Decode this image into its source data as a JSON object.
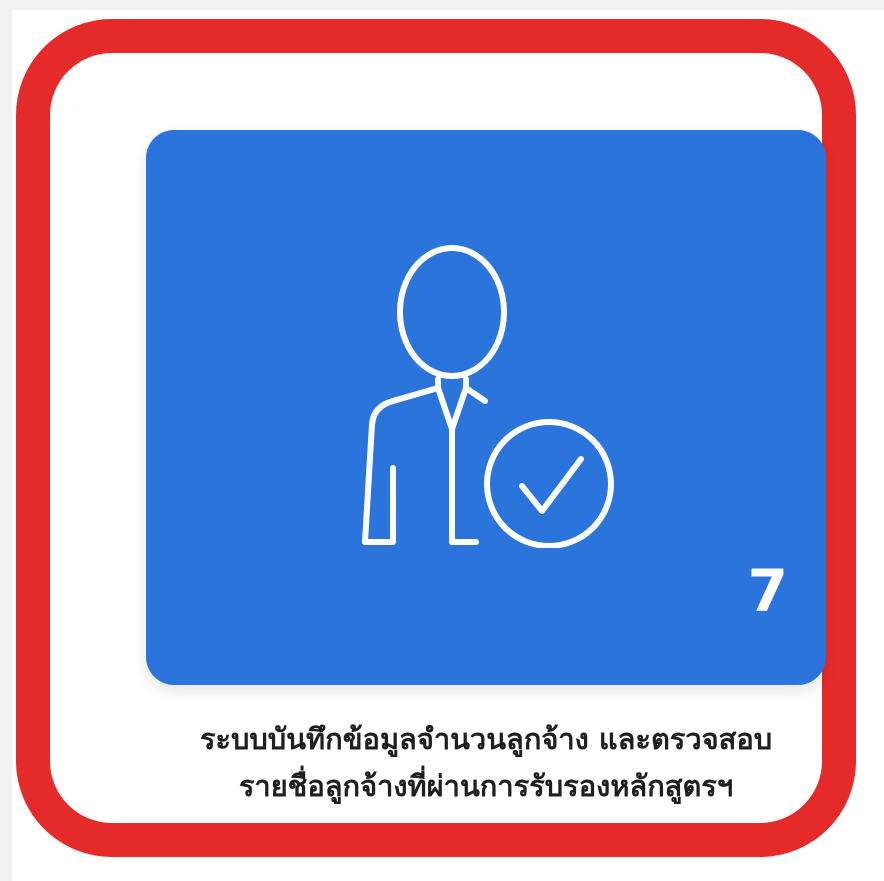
{
  "card": {
    "icon": "user-verified-icon",
    "count": "7",
    "caption_line1": "ระบบบันทึกข้อมูลจำนวนลูกจ้าง และตรวจสอบ",
    "caption_line2": "รายชื่อลูกจ้างที่ผ่านการรับรองหลักสูตรฯ"
  },
  "colors": {
    "highlight": "#e52a2a",
    "tile": "#2b74dc",
    "caption_text": "#1f1f1f",
    "background": "#ffffff"
  }
}
